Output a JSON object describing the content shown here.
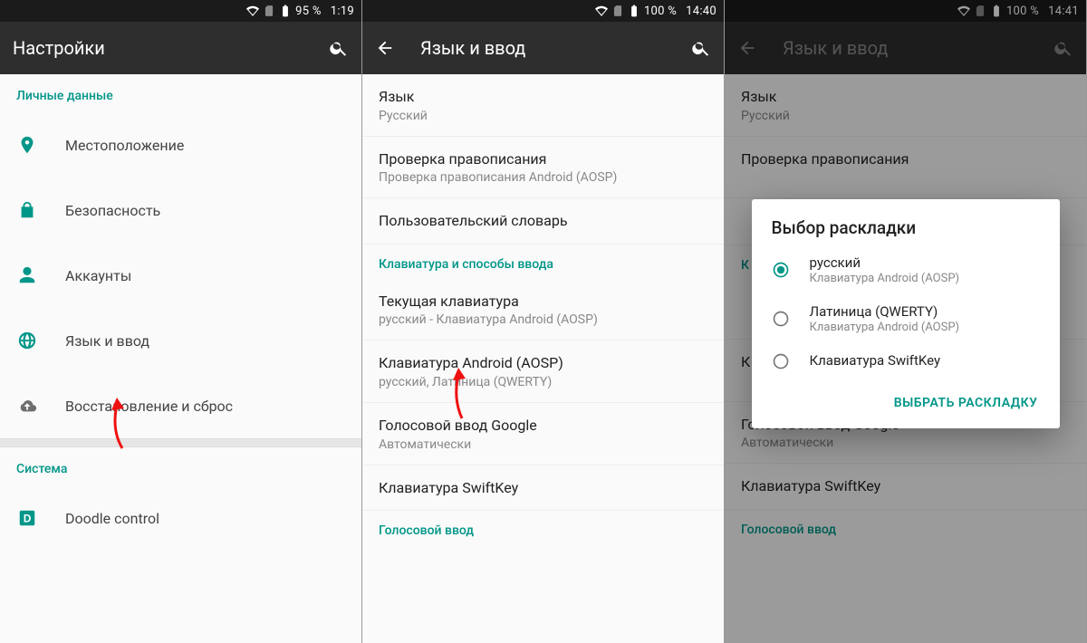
{
  "colors": {
    "accent": "#009688"
  },
  "screen1": {
    "status": {
      "battery": "95 %",
      "time": "1:19"
    },
    "title": "Настройки",
    "section_personal": "Личные данные",
    "items": {
      "location": "Местоположение",
      "security": "Безопасность",
      "accounts": "Аккаунты",
      "language": "Язык и ввод",
      "backup": "Восстановление и сброс"
    },
    "section_system": "Система",
    "doodle": "Doodle control"
  },
  "screen2": {
    "status": {
      "battery": "100 %",
      "time": "14:40"
    },
    "title": "Язык и ввод",
    "prefs": {
      "lang_t": "Язык",
      "lang_s": "Русский",
      "spell_t": "Проверка правописания",
      "spell_s": "Проверка правописания Android (AOSP)",
      "dict_t": "Пользовательский словарь",
      "section_kb": "Клавиатура и способы ввода",
      "curkb_t": "Текущая клавиатура",
      "curkb_s": "русский - Клавиатура Android (AOSP)",
      "aosp_t": "Клавиатура Android (AOSP)",
      "aosp_s": "русский, Латиница (QWERTY)",
      "gvoice_t": "Голосовой ввод Google",
      "gvoice_s": "Автоматически",
      "swift_t": "Клавиатура SwiftKey",
      "section_voice": "Голосовой ввод"
    }
  },
  "screen3": {
    "status": {
      "battery": "100 %",
      "time": "14:41"
    },
    "title": "Язык и ввод",
    "prefs": {
      "lang_t": "Язык",
      "lang_s": "Русский",
      "spell_t": "Проверка правописания",
      "kb_section_initial": "К",
      "aosp_initial": "К",
      "gvoice_t": "Голосовой ввод Google",
      "gvoice_s": "Автоматически",
      "swift_t": "Клавиатура SwiftKey",
      "section_voice": "Голосовой ввод"
    },
    "dialog": {
      "title": "Выбор раскладки",
      "opt1_t": "русский",
      "opt1_s": "Клавиатура Android (AOSP)",
      "opt2_t": "Латиница (QWERTY)",
      "opt2_s": "Клавиатура Android (AOSP)",
      "opt3_t": "Клавиатура SwiftKey",
      "action": "Выбрать раскладку"
    }
  }
}
